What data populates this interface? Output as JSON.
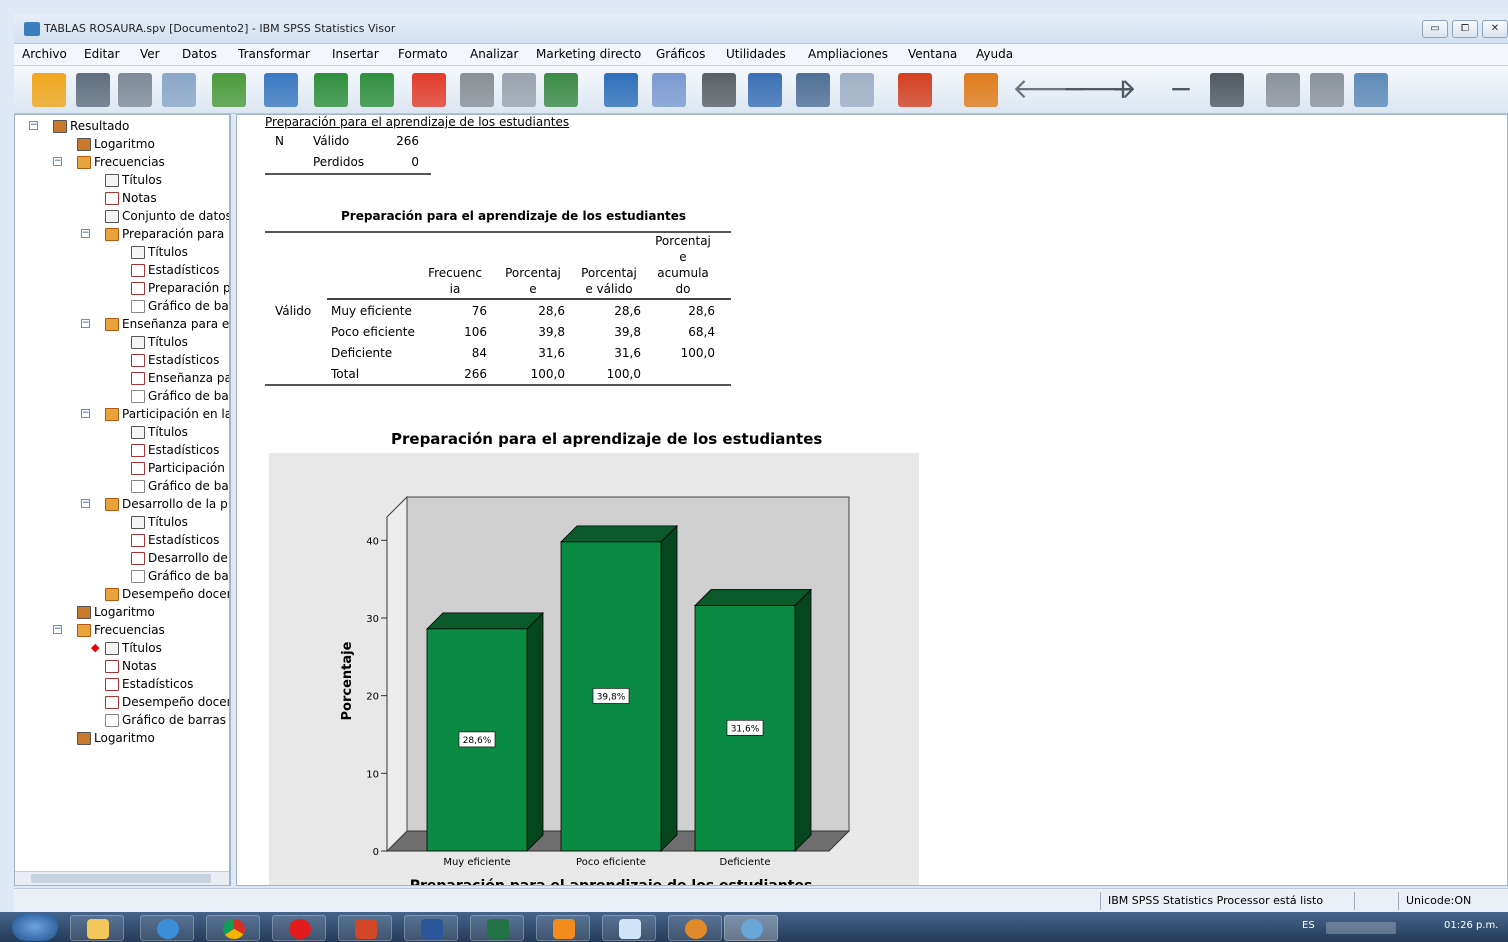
{
  "window": {
    "title": "TABLAS ROSAURA.spv [Documento2] - IBM SPSS Statistics Visor",
    "minimize": "▭",
    "maximize": "⧠",
    "close": "✕"
  },
  "menu": [
    "Archivo",
    "Editar",
    "Ver",
    "Datos",
    "Transformar",
    "Insertar",
    "Formato",
    "Analizar",
    "Marketing directo",
    "Gráficos",
    "Utilidades",
    "Ampliaciones",
    "Ventana",
    "Ayuda"
  ],
  "toolbar_icons": [
    "open-icon",
    "save-icon",
    "print-icon",
    "print-preview-icon",
    "export-icon",
    "recall-dialog-icon",
    "undo-icon",
    "redo-icon",
    "goto-case-icon",
    "goto-variable-icon",
    "variables-icon",
    "split-file-icon",
    "select-cases-icon",
    "value-labels-icon",
    "use-sets-icon",
    "show-all-variables-icon",
    "spellcheck-icon",
    "data-editor-icon",
    "script-icon",
    "designate-window-icon",
    "back-icon",
    "forward-icon",
    "expand-icon",
    "collapse-icon",
    "show-icon",
    "hide-icon",
    "insert-heading-icon",
    "insert-title-icon",
    "insert-text-icon"
  ],
  "outline": [
    {
      "label": "Resultado",
      "level": 0,
      "icon": "book",
      "toggle": "-"
    },
    {
      "label": "Logaritmo",
      "level": 1,
      "icon": "book"
    },
    {
      "label": "Frecuencias",
      "level": 1,
      "icon": "out",
      "toggle": "-"
    },
    {
      "label": "Títulos",
      "level": 2,
      "icon": "note"
    },
    {
      "label": "Notas",
      "level": 2,
      "icon": "tbl"
    },
    {
      "label": "Conjunto de datos",
      "level": 2,
      "icon": "note"
    },
    {
      "label": "Preparación para",
      "level": 2,
      "icon": "out",
      "toggle": "-"
    },
    {
      "label": "Títulos",
      "level": 3,
      "icon": "note"
    },
    {
      "label": "Estadísticos",
      "level": 3,
      "icon": "tbl"
    },
    {
      "label": "Preparación para",
      "level": 3,
      "icon": "tbl"
    },
    {
      "label": "Gráfico de barras",
      "level": 3,
      "icon": "chart"
    },
    {
      "label": "Enseñanza para el",
      "level": 2,
      "icon": "out",
      "toggle": "-"
    },
    {
      "label": "Títulos",
      "level": 3,
      "icon": "note"
    },
    {
      "label": "Estadísticos",
      "level": 3,
      "icon": "tbl"
    },
    {
      "label": "Enseñanza para",
      "level": 3,
      "icon": "tbl"
    },
    {
      "label": "Gráfico de barras",
      "level": 3,
      "icon": "chart"
    },
    {
      "label": "Participación en la",
      "level": 2,
      "icon": "out",
      "toggle": "-"
    },
    {
      "label": "Títulos",
      "level": 3,
      "icon": "note"
    },
    {
      "label": "Estadísticos",
      "level": 3,
      "icon": "tbl"
    },
    {
      "label": "Participación",
      "level": 3,
      "icon": "tbl"
    },
    {
      "label": "Gráfico de barras",
      "level": 3,
      "icon": "chart"
    },
    {
      "label": "Desarrollo de la p",
      "level": 2,
      "icon": "out",
      "toggle": "-"
    },
    {
      "label": "Títulos",
      "level": 3,
      "icon": "note"
    },
    {
      "label": "Estadísticos",
      "level": 3,
      "icon": "tbl"
    },
    {
      "label": "Desarrollo de",
      "level": 3,
      "icon": "tbl"
    },
    {
      "label": "Gráfico de barras",
      "level": 3,
      "icon": "chart"
    },
    {
      "label": "Desempeño docente",
      "level": 2,
      "icon": "out"
    },
    {
      "label": "Logaritmo",
      "level": 1,
      "icon": "book"
    },
    {
      "label": "Frecuencias",
      "level": 1,
      "icon": "out",
      "toggle": "-"
    },
    {
      "label": "Títulos",
      "level": 2,
      "icon": "note",
      "current": true
    },
    {
      "label": "Notas",
      "level": 2,
      "icon": "tbl"
    },
    {
      "label": "Estadísticos",
      "level": 2,
      "icon": "tbl"
    },
    {
      "label": "Desempeño docente",
      "level": 2,
      "icon": "tbl"
    },
    {
      "label": "Gráfico de barras",
      "level": 2,
      "icon": "chart"
    },
    {
      "label": "Logaritmo",
      "level": 1,
      "icon": "book"
    }
  ],
  "stats_table": {
    "title": "Preparación para el aprendizaje de los estudiantes",
    "n_label": "N",
    "rows": [
      {
        "label": "Válido",
        "value": "266"
      },
      {
        "label": "Perdidos",
        "value": "0"
      }
    ]
  },
  "freq_table": {
    "title": "Preparación para el aprendizaje de los estudiantes",
    "headers": [
      "Frecuencia",
      "Porcentaje",
      "Porcentaje válido",
      "Porcentaje acumulado"
    ],
    "header_lines": [
      [
        "Frecuenc",
        "ia"
      ],
      [
        "Porcentaj",
        "e"
      ],
      [
        "Porcentaj",
        "e válido"
      ],
      [
        "Porcentaj",
        "e",
        "acumula",
        "do"
      ]
    ],
    "group_label": "Válido",
    "rows": [
      {
        "label": "Muy eficiente",
        "freq": "76",
        "pct": "28,6",
        "valid": "28,6",
        "cum": "28,6"
      },
      {
        "label": "Poco eficiente",
        "freq": "106",
        "pct": "39,8",
        "valid": "39,8",
        "cum": "68,4"
      },
      {
        "label": "Deficiente",
        "freq": "84",
        "pct": "31,6",
        "valid": "31,6",
        "cum": "100,0"
      },
      {
        "label": "Total",
        "freq": "266",
        "pct": "100,0",
        "valid": "100,0",
        "cum": ""
      }
    ]
  },
  "chart_data": {
    "type": "bar",
    "title": "Preparación para el aprendizaje de los estudiantes",
    "xlabel": "Preparación para el aprendizaje de los estudiantes",
    "ylabel": "Porcentaje",
    "categories": [
      "Muy eficiente",
      "Poco eficiente",
      "Deficiente"
    ],
    "values": [
      28.6,
      39.8,
      31.6
    ],
    "data_labels": [
      "28,6%",
      "39,8%",
      "31,6%"
    ],
    "ylim": [
      0,
      43
    ],
    "yticks": [
      "0",
      "10",
      "20",
      "30",
      "40"
    ],
    "bar_color": "#0b8a43",
    "style": "3d",
    "grid": false
  },
  "status": {
    "message": "IBM SPSS Statistics Processor está listo",
    "unicode": "Unicode:ON"
  },
  "tray": {
    "lang": "ES",
    "time": "01:26 p.m."
  }
}
